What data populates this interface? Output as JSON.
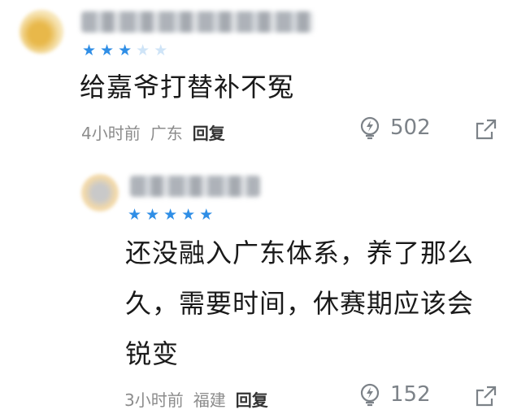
{
  "comments": [
    {
      "rating": 3,
      "rating_max": 5,
      "text": "给嘉爷打替补不冤",
      "time": "4小时前",
      "location": "广东",
      "reply_label": "回复",
      "likes": "502"
    },
    {
      "rating": 5,
      "rating_max": 5,
      "text": "还没融入广东体系，养了那么久，需要时间，休赛期应该会锐变",
      "time": "3小时前",
      "location": "福建",
      "reply_label": "回复",
      "likes": "152"
    }
  ],
  "icons": {
    "like": "lightning-bulb-icon",
    "share": "share-out-icon"
  },
  "colors": {
    "star_on": "#2f8ee6",
    "star_off": "#cfe4f7",
    "meta_text": "#8c8c8c"
  }
}
